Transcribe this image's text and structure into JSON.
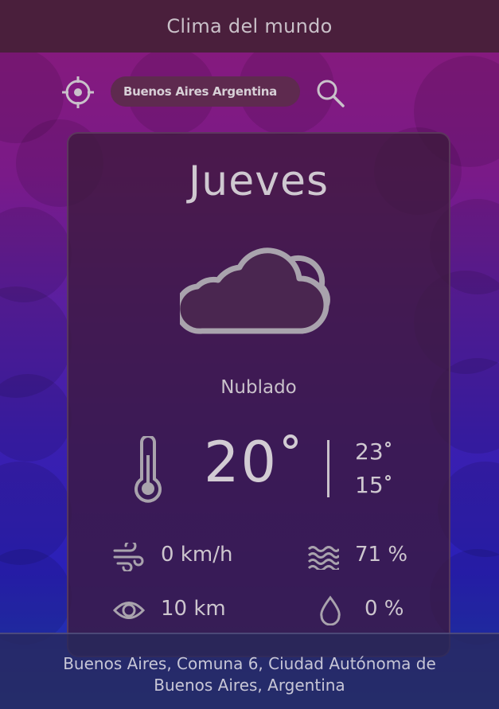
{
  "app": {
    "title": "Clima del mundo"
  },
  "search": {
    "value": "Buenos Aires Argentina",
    "placeholder": "Buenos Aires Argentina"
  },
  "forecast": {
    "day": "Jueves",
    "condition": "Nublado",
    "icon": "cloud-icon",
    "temperature": "20",
    "temp_max": "23",
    "temp_min": "15"
  },
  "stats": {
    "wind": "0 km/h",
    "humidity": "71 %",
    "visibility": "10 km",
    "precipitation": "0 %"
  },
  "location": {
    "full_name": "Buenos Aires, Comuna 6, Ciudad Autónoma de Buenos Aires, Argentina"
  },
  "colors": {
    "header": "#4a1f3c",
    "card": "#3c193c",
    "footer": "#28285a"
  }
}
